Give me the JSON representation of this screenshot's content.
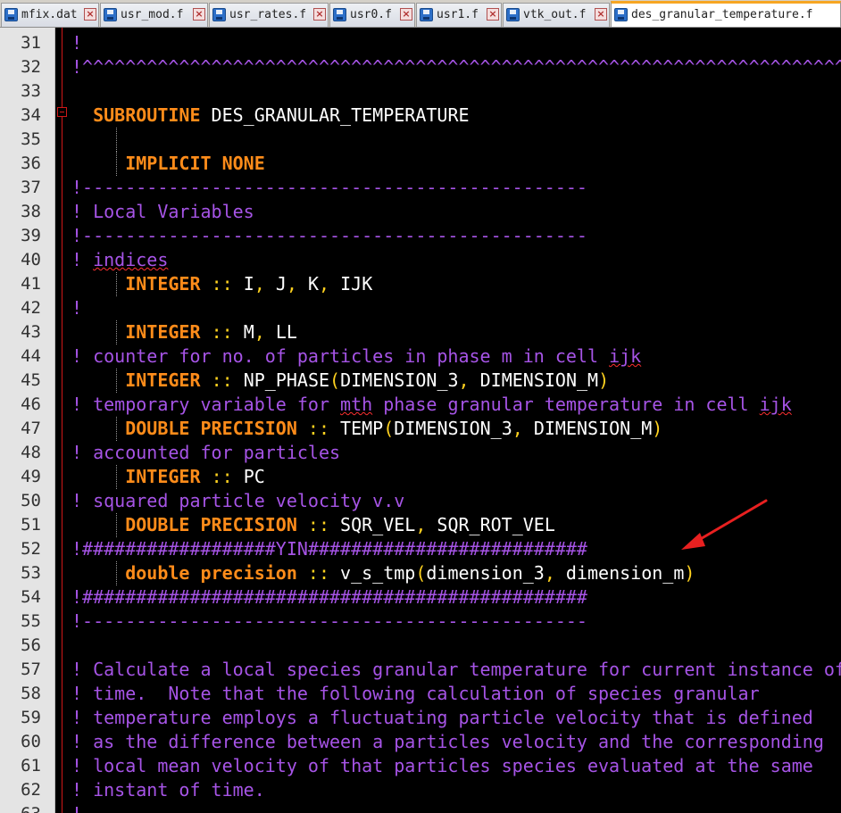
{
  "tabs": [
    {
      "label": "mfix.dat",
      "active": false
    },
    {
      "label": "usr_mod.f",
      "active": false
    },
    {
      "label": "usr_rates.f",
      "active": false
    },
    {
      "label": "usr0.f",
      "active": false
    },
    {
      "label": "usr1.f",
      "active": false
    },
    {
      "label": "vtk_out.f",
      "active": false
    },
    {
      "label": "des_granular_temperature.f",
      "active": true
    }
  ],
  "editor": {
    "lines": [
      {
        "num": "31",
        "parts": [
          [
            "c",
            "!"
          ]
        ]
      },
      {
        "num": "32",
        "parts": [
          [
            "c",
            "!^^^^^^^^^^^^^^^^^^^^^^^^^^^^^^^^^^^^^^^^^^^^^^^^^^^^^^^^^^^^^^^^^^^^^^^^^^^^^^^^^^^^^^"
          ]
        ]
      },
      {
        "num": "33",
        "parts": []
      },
      {
        "num": "34",
        "parts": [
          [
            "t",
            "  "
          ],
          [
            "k",
            "SUBROUTINE"
          ],
          [
            "t",
            " DES_GRANULAR_TEMPERATURE"
          ]
        ]
      },
      {
        "num": "35",
        "guide": true,
        "parts": []
      },
      {
        "num": "36",
        "guide": true,
        "parts": [
          [
            "t",
            "     "
          ],
          [
            "k",
            "IMPLICIT NONE"
          ]
        ]
      },
      {
        "num": "37",
        "parts": [
          [
            "c",
            "!-----------------------------------------------"
          ]
        ]
      },
      {
        "num": "38",
        "parts": [
          [
            "c",
            "! Local Variables"
          ]
        ]
      },
      {
        "num": "39",
        "parts": [
          [
            "c",
            "!-----------------------------------------------"
          ]
        ]
      },
      {
        "num": "40",
        "parts": [
          [
            "c",
            "! "
          ],
          [
            "csq",
            "indices"
          ]
        ]
      },
      {
        "num": "41",
        "guide": true,
        "parts": [
          [
            "t",
            "     "
          ],
          [
            "k",
            "INTEGER"
          ],
          [
            "t",
            " "
          ],
          [
            "op",
            "::"
          ],
          [
            "t",
            " I"
          ],
          [
            "op",
            ","
          ],
          [
            "t",
            " J"
          ],
          [
            "op",
            ","
          ],
          [
            "t",
            " K"
          ],
          [
            "op",
            ","
          ],
          [
            "t",
            " IJK"
          ]
        ]
      },
      {
        "num": "42",
        "parts": [
          [
            "c",
            "!"
          ]
        ]
      },
      {
        "num": "43",
        "guide": true,
        "parts": [
          [
            "t",
            "     "
          ],
          [
            "k",
            "INTEGER"
          ],
          [
            "t",
            " "
          ],
          [
            "op",
            "::"
          ],
          [
            "t",
            " M"
          ],
          [
            "op",
            ","
          ],
          [
            "t",
            " LL"
          ]
        ]
      },
      {
        "num": "44",
        "parts": [
          [
            "c",
            "! counter for no. of particles in phase m in cell "
          ],
          [
            "csq",
            "ijk"
          ]
        ]
      },
      {
        "num": "45",
        "guide": true,
        "parts": [
          [
            "t",
            "     "
          ],
          [
            "k",
            "INTEGER"
          ],
          [
            "t",
            " "
          ],
          [
            "op",
            "::"
          ],
          [
            "t",
            " NP_PHASE"
          ],
          [
            "op",
            "("
          ],
          [
            "t",
            "DIMENSION_3"
          ],
          [
            "op",
            ","
          ],
          [
            "t",
            " DIMENSION_M"
          ],
          [
            "op",
            ")"
          ]
        ]
      },
      {
        "num": "46",
        "parts": [
          [
            "c",
            "! temporary variable for "
          ],
          [
            "csq",
            "mth"
          ],
          [
            "c",
            " phase granular temperature in cell "
          ],
          [
            "csq",
            "ijk"
          ]
        ]
      },
      {
        "num": "47",
        "guide": true,
        "parts": [
          [
            "t",
            "     "
          ],
          [
            "k",
            "DOUBLE PRECISION"
          ],
          [
            "t",
            " "
          ],
          [
            "op",
            "::"
          ],
          [
            "t",
            " TEMP"
          ],
          [
            "op",
            "("
          ],
          [
            "t",
            "DIMENSION_3"
          ],
          [
            "op",
            ","
          ],
          [
            "t",
            " DIMENSION_M"
          ],
          [
            "op",
            ")"
          ]
        ]
      },
      {
        "num": "48",
        "parts": [
          [
            "c",
            "! accounted for particles"
          ]
        ]
      },
      {
        "num": "49",
        "guide": true,
        "parts": [
          [
            "t",
            "     "
          ],
          [
            "k",
            "INTEGER"
          ],
          [
            "t",
            " "
          ],
          [
            "op",
            "::"
          ],
          [
            "t",
            " PC"
          ]
        ]
      },
      {
        "num": "50",
        "parts": [
          [
            "c",
            "! squared particle velocity v.v"
          ]
        ]
      },
      {
        "num": "51",
        "guide": true,
        "parts": [
          [
            "t",
            "     "
          ],
          [
            "k",
            "DOUBLE PRECISION"
          ],
          [
            "t",
            " "
          ],
          [
            "op",
            "::"
          ],
          [
            "t",
            " SQR_VEL"
          ],
          [
            "op",
            ","
          ],
          [
            "t",
            " SQR_ROT_VEL"
          ]
        ]
      },
      {
        "num": "52",
        "parts": [
          [
            "c",
            "!##################YIN##########################"
          ]
        ]
      },
      {
        "num": "53",
        "guide": true,
        "parts": [
          [
            "t",
            "     "
          ],
          [
            "k",
            "double precision"
          ],
          [
            "t",
            " "
          ],
          [
            "op",
            "::"
          ],
          [
            "t",
            " v_s_tmp"
          ],
          [
            "op",
            "("
          ],
          [
            "t",
            "dimension_3"
          ],
          [
            "op",
            ","
          ],
          [
            "t",
            " dimension_m"
          ],
          [
            "op",
            ")"
          ]
        ]
      },
      {
        "num": "54",
        "parts": [
          [
            "c",
            "!###############################################"
          ]
        ]
      },
      {
        "num": "55",
        "parts": [
          [
            "c",
            "!-----------------------------------------------"
          ]
        ]
      },
      {
        "num": "56",
        "parts": []
      },
      {
        "num": "57",
        "parts": [
          [
            "c",
            "! Calculate a local species granular temperature for current instance of"
          ]
        ]
      },
      {
        "num": "58",
        "parts": [
          [
            "c",
            "! time.  Note that the following calculation of species granular"
          ]
        ]
      },
      {
        "num": "59",
        "parts": [
          [
            "c",
            "! temperature employs a fluctuating particle velocity that is defined"
          ]
        ]
      },
      {
        "num": "60",
        "parts": [
          [
            "c",
            "! as the difference between a particles velocity and the corresponding"
          ]
        ]
      },
      {
        "num": "61",
        "parts": [
          [
            "c",
            "! local mean velocity of that particles species evaluated at the same"
          ]
        ]
      },
      {
        "num": "62",
        "parts": [
          [
            "c",
            "! instant of time."
          ]
        ]
      },
      {
        "num": "63",
        "parts": [
          [
            "c",
            "!-----------------------------------------------"
          ]
        ]
      }
    ]
  }
}
